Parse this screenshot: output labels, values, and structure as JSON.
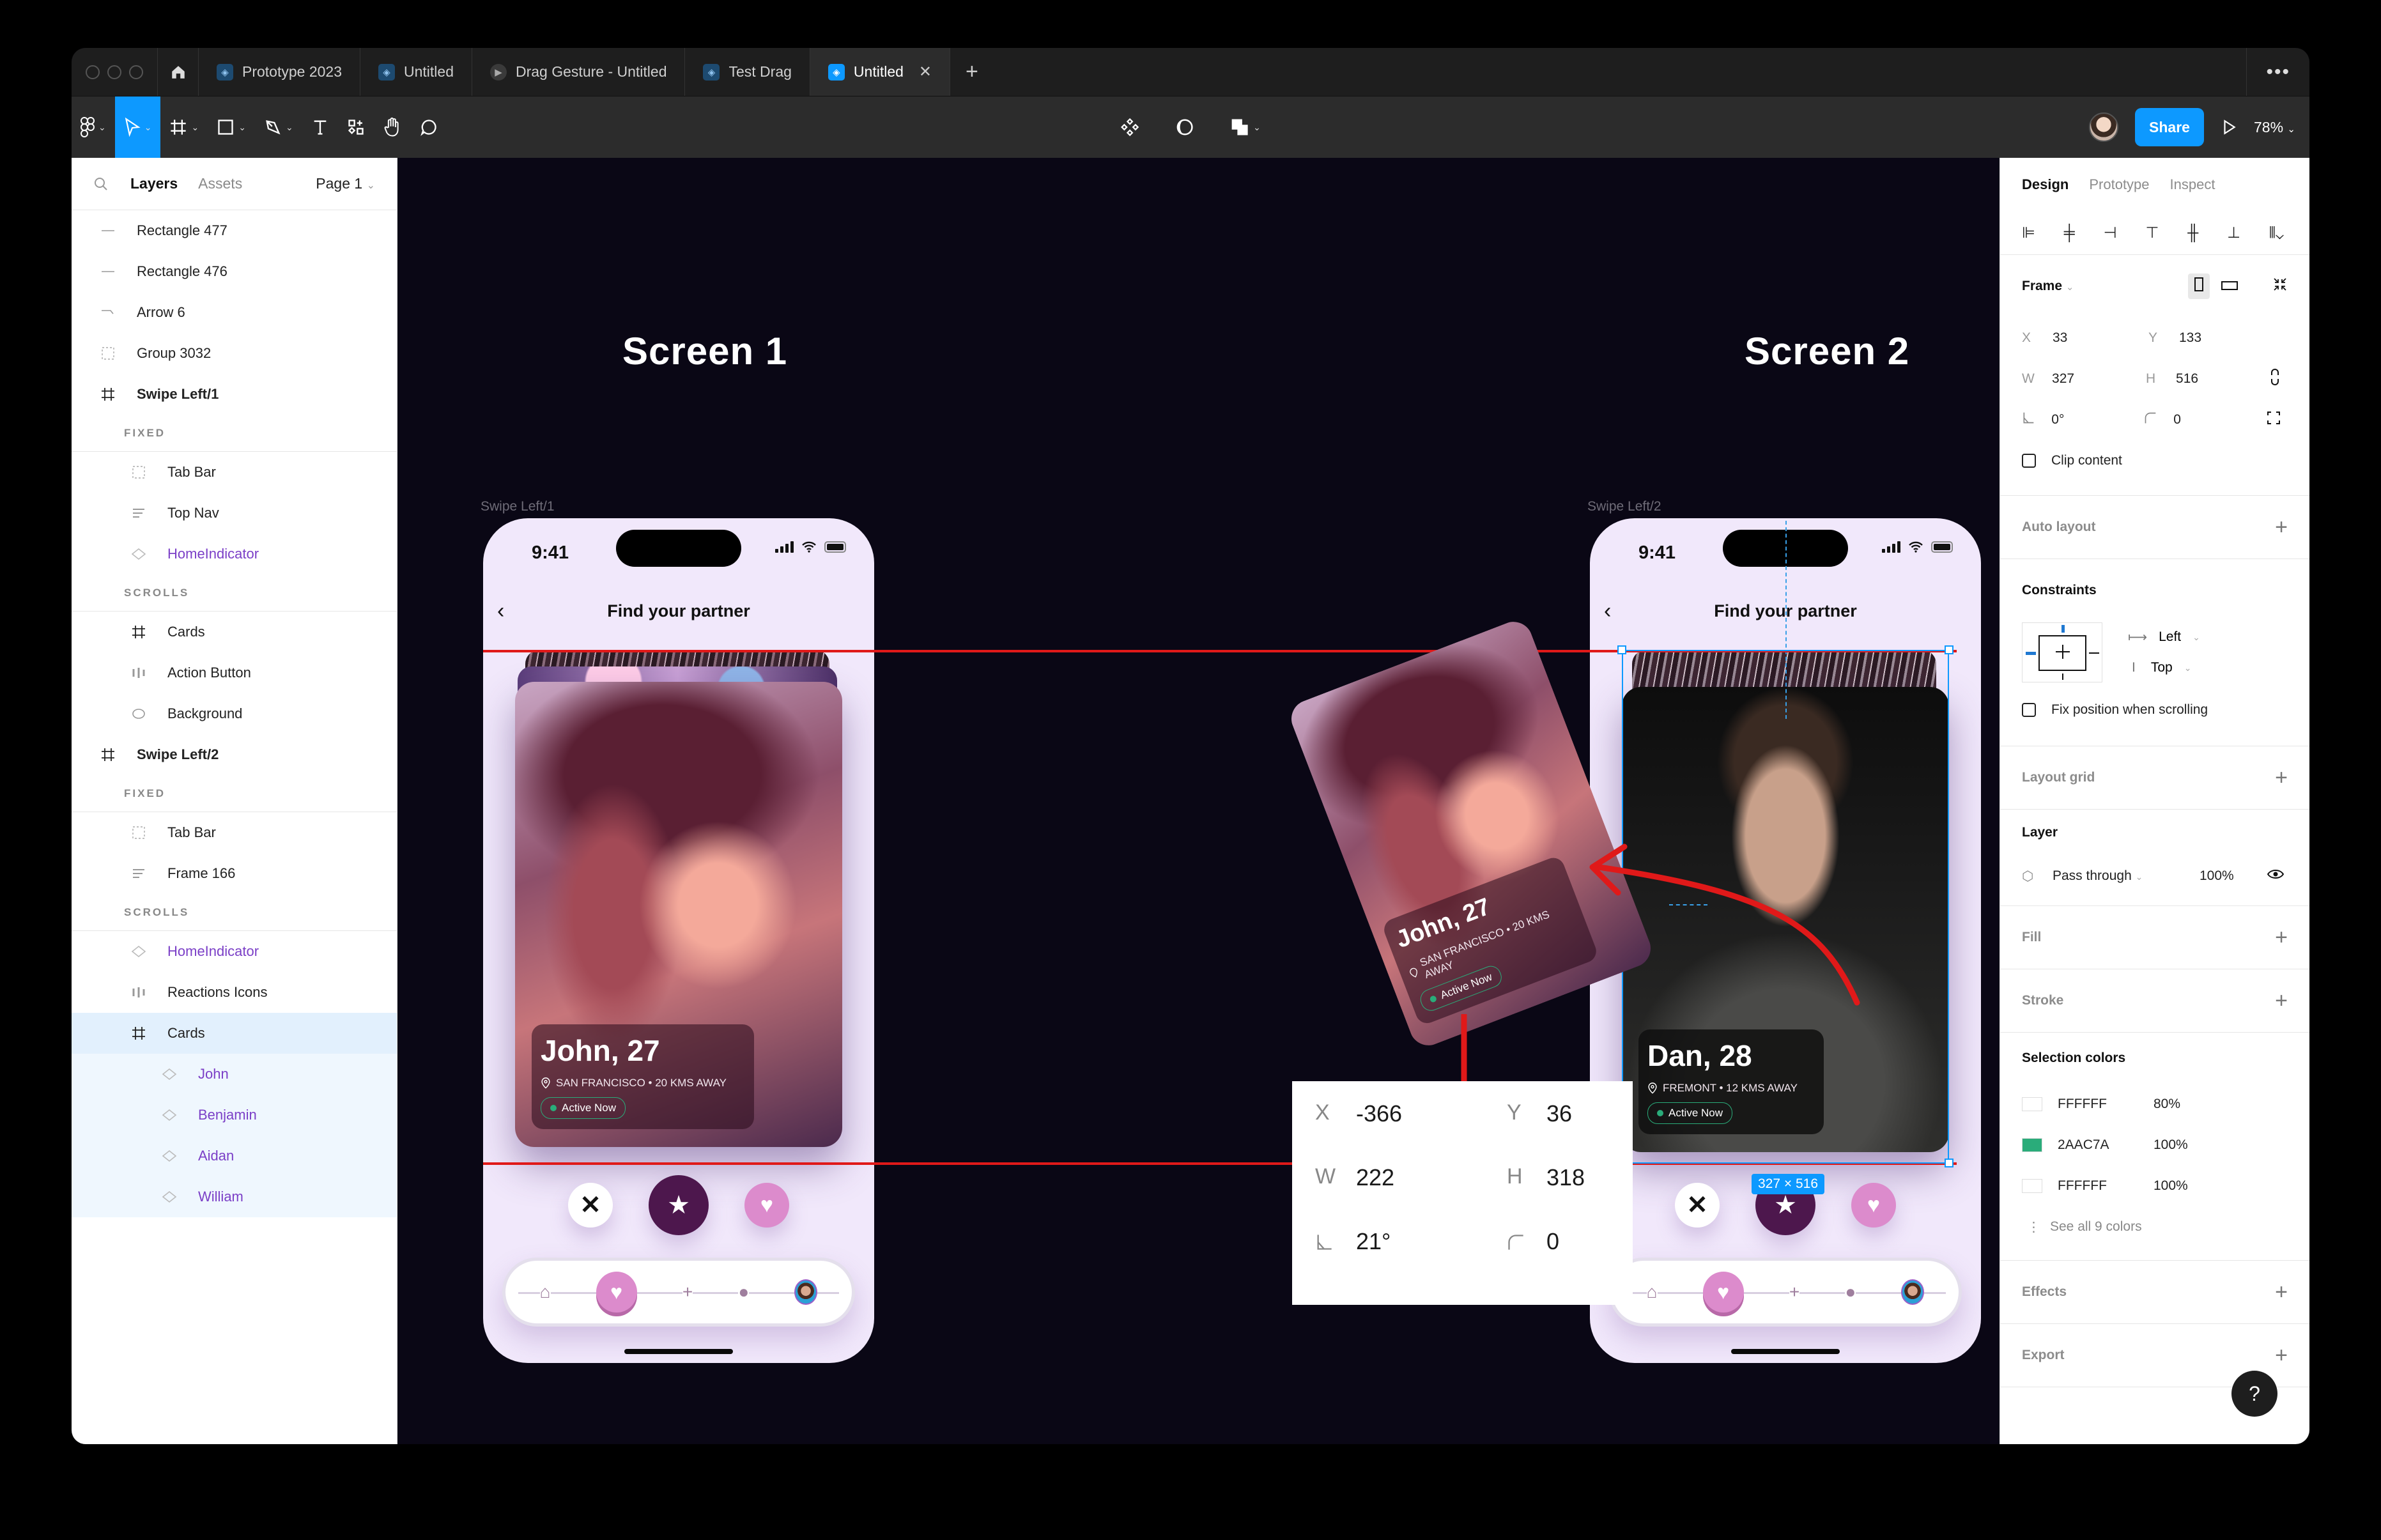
{
  "tabs": [
    {
      "label": "Prototype 2023",
      "icon": "figma-file-icon",
      "active": false
    },
    {
      "label": "Untitled",
      "icon": "figma-file-icon",
      "active": false
    },
    {
      "label": "Drag Gesture - Untitled",
      "icon": "play-icon",
      "active": false
    },
    {
      "label": "Test Drag",
      "icon": "figma-file-icon",
      "active": false
    },
    {
      "label": "Untitled",
      "icon": "figma-file-icon",
      "active": true
    }
  ],
  "toolbar": {
    "share_label": "Share",
    "zoom": "78%"
  },
  "left_panel": {
    "tab_layers": "Layers",
    "tab_assets": "Assets",
    "page": "Page 1",
    "layers": [
      {
        "label": "Rectangle 477",
        "icon": "line-icon",
        "level": 0
      },
      {
        "label": "Rectangle 476",
        "icon": "line-icon",
        "level": 0
      },
      {
        "label": "Arrow 6",
        "icon": "arrow-icon",
        "level": 0
      },
      {
        "label": "Group 3032",
        "icon": "group-icon",
        "level": 0
      },
      {
        "label": "Swipe Left/1",
        "icon": "frame-icon",
        "level": 0,
        "bold": true
      },
      {
        "label": "FIXED",
        "section": true
      },
      {
        "label": "Tab Bar",
        "icon": "group-icon",
        "level": 1
      },
      {
        "label": "Top Nav",
        "icon": "autolayout-icon",
        "level": 1
      },
      {
        "label": "HomeIndicator",
        "icon": "component-icon",
        "level": 1,
        "component": true
      },
      {
        "label": "SCROLLS",
        "section": true
      },
      {
        "label": "Cards",
        "icon": "frame-icon",
        "level": 1
      },
      {
        "label": "Action Button",
        "icon": "autolayout-h-icon",
        "level": 1
      },
      {
        "label": "Background",
        "icon": "ellipse-icon",
        "level": 1
      },
      {
        "label": "Swipe Left/2",
        "icon": "frame-icon",
        "level": 0,
        "bold": true
      },
      {
        "label": "FIXED",
        "section": true
      },
      {
        "label": "Tab Bar",
        "icon": "group-icon",
        "level": 1
      },
      {
        "label": "Frame 166",
        "icon": "autolayout-icon",
        "level": 1
      },
      {
        "label": "SCROLLS",
        "section": true
      },
      {
        "label": "HomeIndicator",
        "icon": "component-icon",
        "level": 1,
        "component": true
      },
      {
        "label": "Reactions Icons",
        "icon": "autolayout-h-icon",
        "level": 1
      },
      {
        "label": "Cards",
        "icon": "frame-icon",
        "level": 1,
        "selected": true
      },
      {
        "label": "John",
        "icon": "component-icon",
        "level": 2,
        "component": true,
        "selchild": true
      },
      {
        "label": "Benjamin",
        "icon": "component-icon",
        "level": 2,
        "component": true,
        "selchild": true
      },
      {
        "label": "Aidan",
        "icon": "component-icon",
        "level": 2,
        "component": true,
        "selchild": true
      },
      {
        "label": "William",
        "icon": "component-icon",
        "level": 2,
        "component": true,
        "selchild": true
      }
    ]
  },
  "canvas": {
    "screen1_title": "Screen 1",
    "screen2_title": "Screen 2",
    "frame1_label": "Swipe Left/1",
    "frame2_label": "Swipe Left/2",
    "phone": {
      "time": "9:41",
      "nav_title": "Find your partner"
    },
    "card_john": {
      "name": "John, 27",
      "location": "SAN FRANCISCO • 20 KMS AWAY",
      "status": "Active Now"
    },
    "card_dan": {
      "name": "Dan, 28",
      "location": "FREMONT • 12 KMS AWAY",
      "status": "Active Now"
    },
    "selection_size": "327 × 516",
    "props_callout": {
      "x_label": "X",
      "x": "-366",
      "y_label": "Y",
      "y": "36",
      "w_label": "W",
      "w": "222",
      "h_label": "H",
      "h": "318",
      "rotation": "21°",
      "radius": "0"
    }
  },
  "right_panel": {
    "tabs": [
      "Design",
      "Prototype",
      "Inspect"
    ],
    "frame_label": "Frame",
    "x_label": "X",
    "x": "33",
    "y_label": "Y",
    "y": "133",
    "w_label": "W",
    "w": "327",
    "h_label": "H",
    "h": "516",
    "rotation": "0°",
    "radius": "0",
    "clip_content": "Clip content",
    "auto_layout": "Auto layout",
    "constraints": "Constraints",
    "constraint_h": "Left",
    "constraint_v": "Top",
    "fix_position": "Fix position when scrolling",
    "layout_grid": "Layout grid",
    "layer": "Layer",
    "blend_mode": "Pass through",
    "opacity": "100%",
    "fill": "Fill",
    "stroke": "Stroke",
    "selection_colors": "Selection colors",
    "colors": [
      {
        "hex": "FFFFFF",
        "opacity": "80%",
        "swatch": "#FFFFFF"
      },
      {
        "hex": "2AAC7A",
        "opacity": "100%",
        "swatch": "#2AAC7A"
      },
      {
        "hex": "FFFFFF",
        "opacity": "100%",
        "swatch": "#FFFFFF"
      }
    ],
    "see_all": "See all 9 colors",
    "effects": "Effects",
    "export": "Export",
    "help": "?"
  },
  "colors": {
    "accent": "#0d99ff",
    "annotation_red": "#e01919",
    "active_green": "#2aac7a",
    "component_purple": "#7b3fc7"
  }
}
